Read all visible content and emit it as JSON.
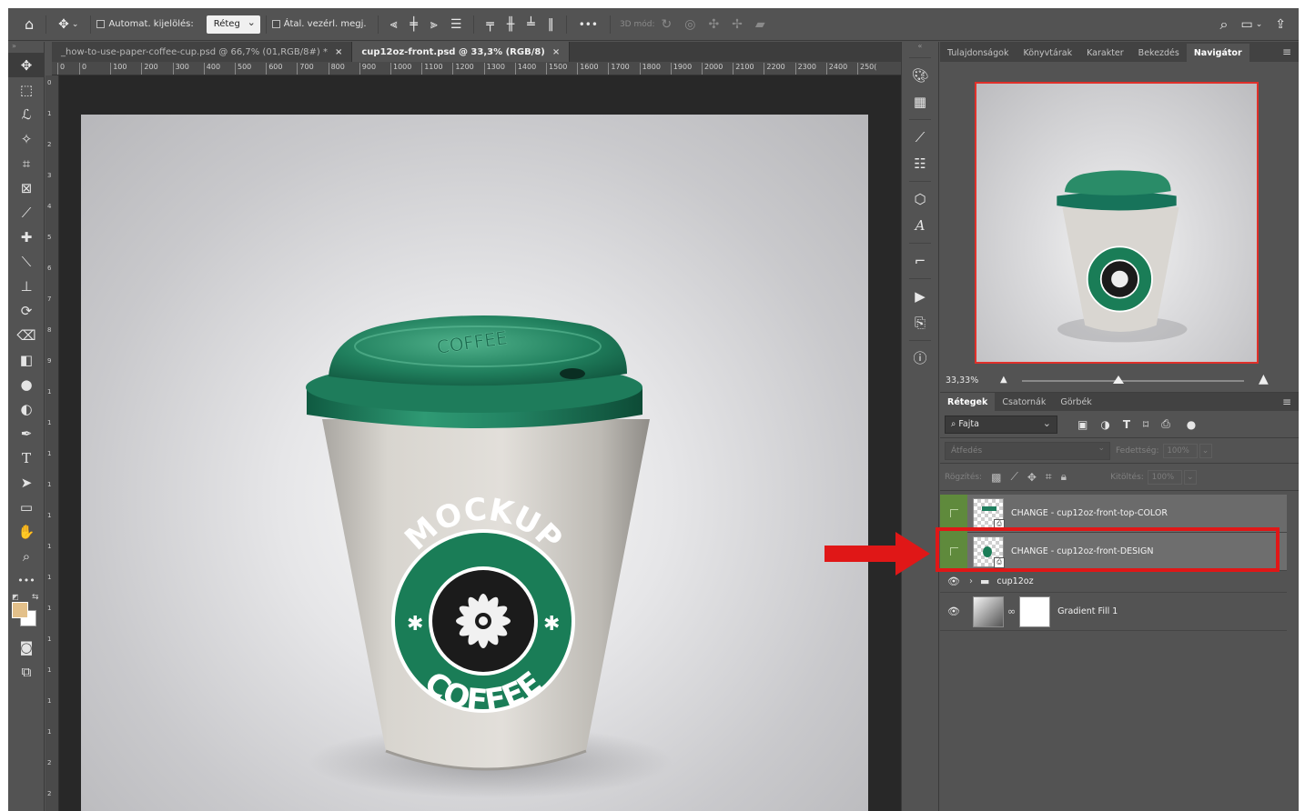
{
  "options_bar": {
    "auto_select_label": "Automat. kijelölés:",
    "auto_select_value": "Réteg",
    "transform_controls_label": "Átal. vezérl. megj.",
    "mode_3d_label": "3D mód:"
  },
  "doc_tabs": [
    {
      "label": "_how-to-use-paper-coffee-cup.psd @ 66,7% (01,RGB/8#) *",
      "close": "×"
    },
    {
      "label": "cup12oz-front.psd @ 33,3% (RGB/8)",
      "close": "×"
    }
  ],
  "ruler_h": [
    "0",
    "0",
    "100",
    "200",
    "300",
    "400",
    "500",
    "600",
    "700",
    "800",
    "900",
    "1000",
    "1100",
    "1200",
    "1300",
    "1400",
    "1500",
    "1600",
    "1700",
    "1800",
    "1900",
    "2000",
    "2100",
    "2200",
    "2300",
    "2400",
    "250("
  ],
  "ruler_v": [
    "0",
    "1",
    "2",
    "3",
    "4",
    "5",
    "6",
    "7",
    "8",
    "9",
    "1",
    "1",
    "1",
    "1",
    "1",
    "1",
    "1",
    "1",
    "1",
    "1",
    "1",
    "1",
    "2",
    "2"
  ],
  "cup": {
    "logo_top": "MOCKUP",
    "logo_bottom": "COFFEE",
    "lid_text": "COFFEE"
  },
  "panel_tabs": [
    {
      "label": "Tulajdonságok"
    },
    {
      "label": "Könyvtárak"
    },
    {
      "label": "Karakter"
    },
    {
      "label": "Bekezdés"
    },
    {
      "label": "Navigátor"
    }
  ],
  "navigator": {
    "zoom": "33,33%"
  },
  "layers_tabs": [
    {
      "label": "Rétegek"
    },
    {
      "label": "Csatornák"
    },
    {
      "label": "Görbék"
    }
  ],
  "layers_filter": {
    "kind": "Fajta"
  },
  "blend": {
    "mode": "Átfedés",
    "opacity_label": "Fedettség:",
    "opacity_value": "100%",
    "lock_label": "Rögzítés:",
    "fill_label": "Kitöltés:",
    "fill_value": "100%"
  },
  "layers": [
    {
      "name": "CHANGE - cup12oz-front-top-COLOR"
    },
    {
      "name": "CHANGE - cup12oz-front-DESIGN"
    },
    {
      "name": "cup12oz"
    },
    {
      "name": "Gradient Fill 1"
    }
  ],
  "colors": {
    "foreground": "#e3c08a",
    "background": "#ffffff",
    "lid_green": "#1f7e5e",
    "highlight_red": "#e01717",
    "layer_green": "#5f8a3c"
  }
}
